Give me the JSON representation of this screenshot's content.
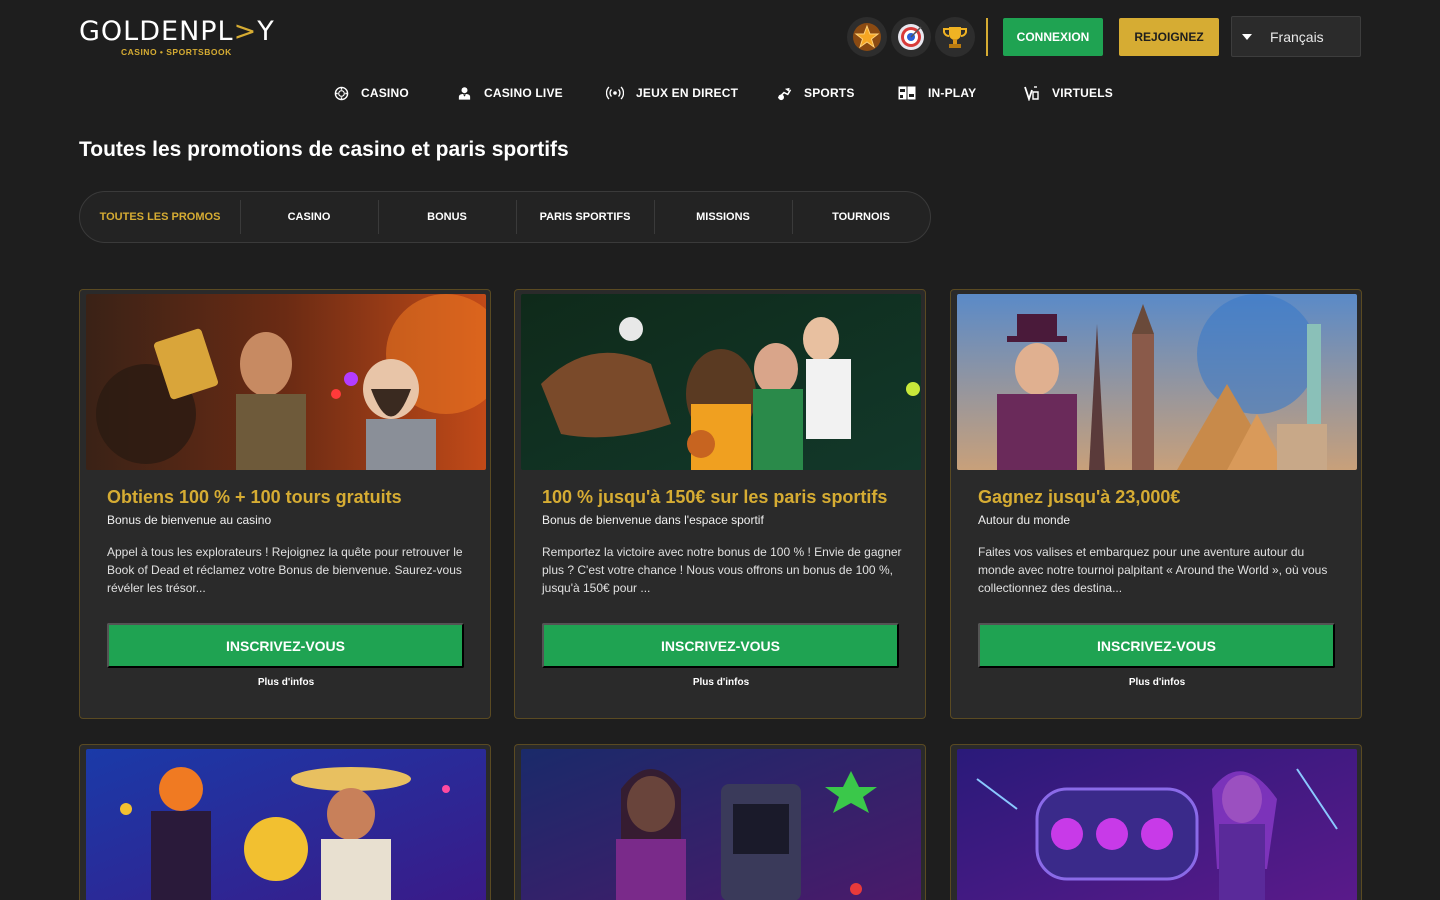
{
  "brand": {
    "logo_main_a": "GOLDENPL",
    "logo_main_b": "Y",
    "logo_arrow": "&gt;",
    "logo_sub": "CASINO • SPORTSBOOK"
  },
  "header": {
    "badges": [
      "star-badge-icon",
      "target-badge-icon",
      "trophy-badge-icon"
    ],
    "login_label": "CONNEXION",
    "join_label": "REJOIGNEZ",
    "language": "Français"
  },
  "nav": {
    "items": [
      {
        "label": "CASINO",
        "icon": "chip-icon"
      },
      {
        "label": "CASINO LIVE",
        "icon": "dealer-icon"
      },
      {
        "label": "JEUX EN DIRECT",
        "icon": "broadcast-icon"
      },
      {
        "label": "SPORTS",
        "icon": "sports-icon"
      },
      {
        "label": "IN-PLAY",
        "icon": "in-play-icon"
      },
      {
        "label": "VIRTUELS",
        "icon": "virtual-icon"
      }
    ]
  },
  "page": {
    "title": "Toutes les promotions de casino et paris sportifs"
  },
  "tabs": [
    {
      "label": "TOUTES LES PROMOS",
      "active": true
    },
    {
      "label": "CASINO",
      "active": false
    },
    {
      "label": "BONUS",
      "active": false
    },
    {
      "label": "PARIS SPORTIFS",
      "active": false
    },
    {
      "label": "MISSIONS",
      "active": false
    },
    {
      "label": "TOURNOIS",
      "active": false
    }
  ],
  "promos": [
    {
      "title": "Obtiens 100 % + 100 tours gratuits",
      "subtitle": "Bonus de bienvenue au casino",
      "description": "Appel à tous les explorateurs ! Rejoignez la quête pour retrouver le Book of Dead et réclamez votre Bonus de bienvenue. Saurez-vous révéler les trésor...",
      "cta": "INSCRIVEZ-VOUS",
      "more": "Plus d'infos"
    },
    {
      "title": "100 % jusqu'à 150€ sur les paris sportifs",
      "subtitle": "Bonus de bienvenue dans l'espace sportif",
      "description": "Remportez la victoire avec notre bonus de 100 % ! Envie de gagner plus ? C'est votre chance ! Nous vous offrons un bonus de 100 %, jusqu'à 150€ pour ...",
      "cta": "INSCRIVEZ-VOUS",
      "more": "Plus d'infos"
    },
    {
      "title": "Gagnez jusqu'à 23,000€",
      "subtitle": "Autour du monde",
      "description": "Faites vos valises et embarquez pour une aventure autour du monde avec notre tournoi palpitant « Around the World », où vous collectionnez des destina...",
      "cta": "INSCRIVEZ-VOUS",
      "more": "Plus d'infos"
    }
  ],
  "colors": {
    "background": "#1e1e1e",
    "gold": "#d6ac33",
    "green": "#1fa352",
    "card": "#2a2a2a"
  }
}
